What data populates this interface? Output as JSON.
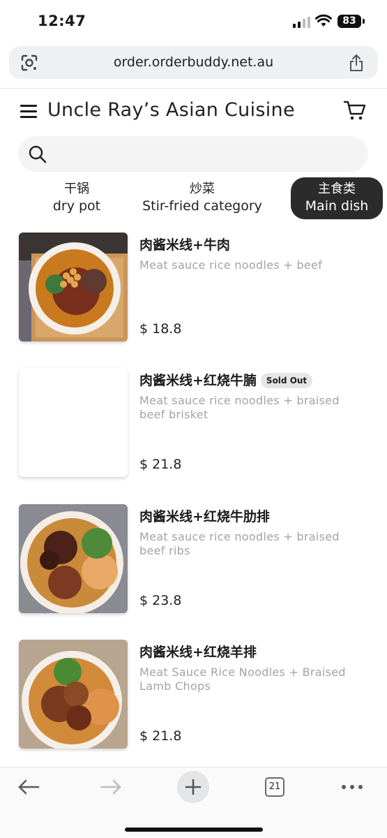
{
  "status_bar": {
    "time": "12:47",
    "battery": "83"
  },
  "browser": {
    "url": "order.orderbuddy.net.au",
    "tab_count": "21"
  },
  "header": {
    "title": "Uncle Ray’s Asian Cuisine"
  },
  "search": {
    "placeholder": ""
  },
  "categories": [
    {
      "zh": "干锅",
      "en": "dry pot",
      "active": false
    },
    {
      "zh": "炒菜",
      "en": "Stir-fried category",
      "active": false
    },
    {
      "zh": "主食类",
      "en": "Main dish",
      "active": true
    }
  ],
  "items": [
    {
      "name": "肉酱米线+牛肉",
      "description": "Meat sauce rice noodles + beef",
      "price": "$ 18.8",
      "sold_out": false
    },
    {
      "name": "肉酱米线+红烧牛腩",
      "description": "Meat sauce rice noodles + braised beef brisket",
      "price": "$ 21.8",
      "sold_out": true,
      "badge": "Sold Out"
    },
    {
      "name": "肉酱米线+红烧牛肋排",
      "description": "Meat sauce rice noodles + braised beef ribs",
      "price": "$ 23.8",
      "sold_out": false
    },
    {
      "name": "肉酱米线+红烧羊排",
      "description": "Meat Sauce Rice Noodles + Braised Lamb Chops",
      "price": "$ 21.8",
      "sold_out": false
    }
  ],
  "colors": {
    "active_tab_bg": "#2b2b2b",
    "description_text": "#a3a3a3",
    "search_bg": "#f4f4f4"
  }
}
